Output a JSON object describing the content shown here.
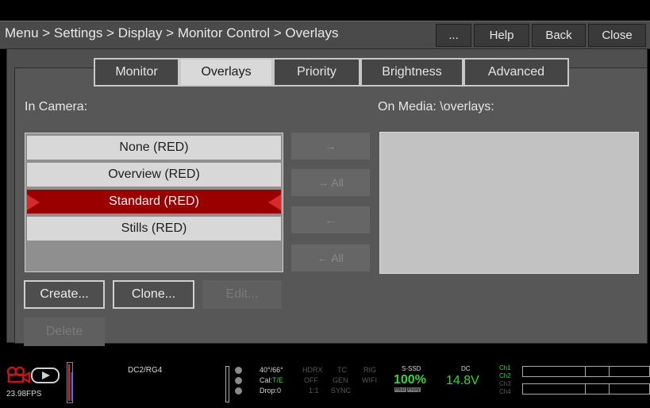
{
  "title": {
    "breadcrumb": "Menu > Settings > Display > Monitor Control > Overlays",
    "more": "...",
    "help": "Help",
    "back": "Back",
    "close": "Close"
  },
  "tabs": [
    {
      "label": "Monitor"
    },
    {
      "label": "Overlays"
    },
    {
      "label": "Priority"
    },
    {
      "label": "Brightness"
    },
    {
      "label": "Advanced"
    }
  ],
  "in_camera": {
    "label": "In Camera:",
    "items": [
      "None (RED)",
      "Overview (RED)",
      "Standard (RED)",
      "Stills (RED)"
    ],
    "selected": "Standard (RED)"
  },
  "on_media": {
    "label": "On Media: \\overlays:"
  },
  "transfer": {
    "to_media": "→",
    "all_to_media": "→ All",
    "to_camera": "←",
    "all_to_camera": "← All"
  },
  "actions": {
    "create": "Create...",
    "clone": "Clone...",
    "edit": "Edit...",
    "delete": "Delete"
  },
  "status": {
    "fps": "23.98FPS",
    "project": "DC2/RG4",
    "temp": "40°/66°",
    "cal_prefix": "Cal:",
    "cal_value": "T/E",
    "drop": "Drop:0",
    "hdrx": "HDRX",
    "hdrx_v": "OFF",
    "hdrx_r": "1:1",
    "tc": "TC",
    "tc_v": "GEN",
    "tc_r": "SYNC",
    "rig": "RIG",
    "rig_v": "WIFI",
    "media_label": "S-SSD",
    "media_value": "100%",
    "media_badge1": "RED",
    "media_badge2": "Proxy",
    "power_label": "DC",
    "power_value": "14.8V",
    "channels": [
      "Ch1",
      "Ch2",
      "Ch3",
      "Ch4"
    ],
    "colors": {
      "accent_red": "#9a0000",
      "status_green": "#39d33b"
    }
  }
}
